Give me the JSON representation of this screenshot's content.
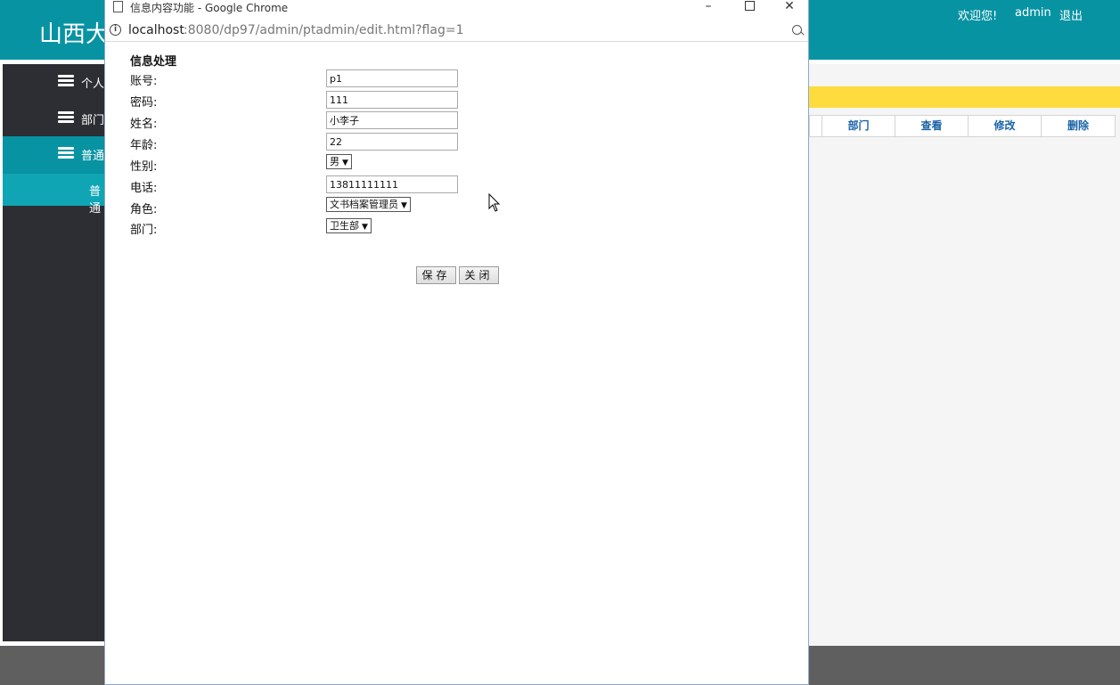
{
  "app": {
    "title": "山西大",
    "welcome": "欢迎您!",
    "user": "admin",
    "logout": "退出"
  },
  "sidebar": {
    "items": [
      {
        "label": "个人"
      },
      {
        "label": "部门"
      },
      {
        "label": "普通"
      }
    ],
    "sub_item": "普通"
  },
  "table": {
    "headers": [
      "部门",
      "查看",
      "修改",
      "删除"
    ]
  },
  "popup": {
    "window_title": "信息内容功能 - Google Chrome",
    "url_host": "localhost",
    "url_path": ":8080/dp97/admin/ptadmin/edit.html?flag=1",
    "form_title": "信息处理",
    "fields": {
      "account": {
        "label": "账号:",
        "value": "p1"
      },
      "password": {
        "label": "密码:",
        "value": "111"
      },
      "name": {
        "label": "姓名:",
        "value": "小李子"
      },
      "age": {
        "label": "年龄:",
        "value": "22"
      },
      "gender": {
        "label": "性别:",
        "value": "男"
      },
      "phone": {
        "label": "电话:",
        "value": "13811111111"
      },
      "role": {
        "label": "角色:",
        "value": "文书档案管理员"
      },
      "department": {
        "label": "部门:",
        "value": "卫生部"
      }
    },
    "buttons": {
      "save": "保存",
      "close": "关闭"
    }
  },
  "colors": {
    "header": "#0893a3",
    "sidebar": "#2c2e33",
    "notice": "#fedc3d",
    "table_header_text": "#1a63a8"
  }
}
